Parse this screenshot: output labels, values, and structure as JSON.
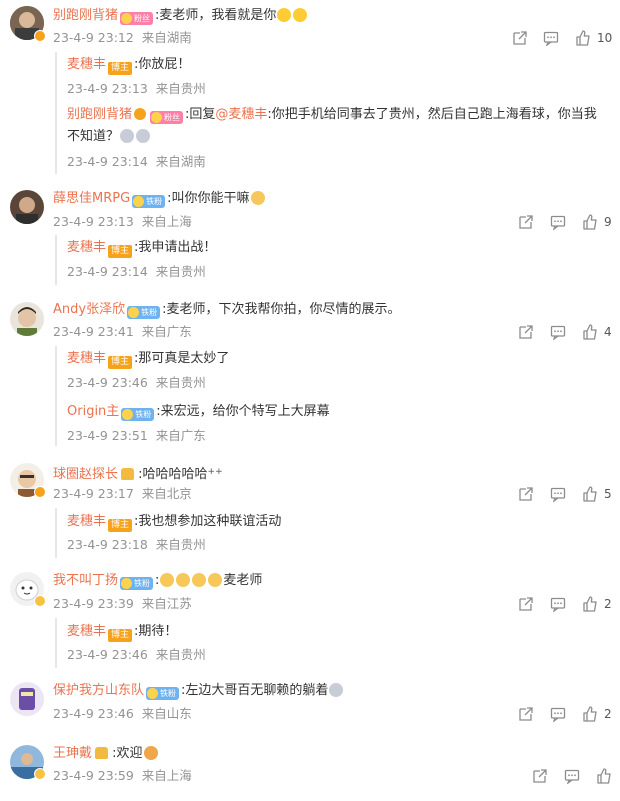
{
  "comments": [
    {
      "user": "别跑刚背猪",
      "badge": "粉丝",
      "text": ":麦老师，我看就是你",
      "time": "23-4-9 23:12",
      "location": "来自湖南",
      "likes": "10",
      "replies": [
        {
          "user": "麦穗丰",
          "badge": "博主",
          "text": ":你放屁！",
          "time": "23-4-9 23:13",
          "location": "来自贵州"
        },
        {
          "user": "别跑刚背猪",
          "badge": "粉丝",
          "text_prefix": ":回复",
          "mention": "@麦穗丰",
          "text": ":你把手机给同事去了贵州，然后自己跑上海看球，你当我",
          "text2": "不知道？",
          "time": "23-4-9 23:14",
          "location": "来自湖南"
        }
      ]
    },
    {
      "user": "薛思佳MRPG",
      "badge": "铁粉",
      "text": ":叫你你能干嘛",
      "time": "23-4-9 23:13",
      "location": "来自上海",
      "likes": "9",
      "replies": [
        {
          "user": "麦穗丰",
          "badge": "博主",
          "text": ":我申请出战！",
          "time": "23-4-9 23:14",
          "location": "来自贵州"
        }
      ]
    },
    {
      "user": "Andy张泽欣",
      "badge": "铁粉",
      "text": ":麦老师，下次我帮你拍，你尽情的展示。",
      "time": "23-4-9 23:41",
      "location": "来自广东",
      "likes": "4",
      "replies": [
        {
          "user": "麦穗丰",
          "badge": "博主",
          "text": ":那可真是太妙了",
          "time": "23-4-9 23:46",
          "location": "来自贵州"
        },
        {
          "user": "Origin主",
          "badge": "铁粉",
          "text": ":来宏远，给你个特写上大屏幕",
          "time": "23-4-9 23:51",
          "location": "来自广东"
        }
      ]
    },
    {
      "user": "球圈赵探长",
      "text": ":哈哈哈哈哈",
      "time": "23-4-9 23:17",
      "location": "来自北京",
      "likes": "5",
      "replies": [
        {
          "user": "麦穗丰",
          "badge": "博主",
          "text": ":我也想参加这种联谊活动",
          "time": "23-4-9 23:18",
          "location": "来自贵州"
        }
      ]
    },
    {
      "user": "我不叫丁扬",
      "badge": "铁粉",
      "text": ":",
      "text_suffix": "麦老师",
      "time": "23-4-9 23:39",
      "location": "来自江苏",
      "likes": "2",
      "replies": [
        {
          "user": "麦穗丰",
          "badge": "博主",
          "text": ":期待！",
          "time": "23-4-9 23:46",
          "location": "来自贵州"
        }
      ]
    },
    {
      "user": "保护我方山东队",
      "badge": "铁粉",
      "text": ":左边大哥百无聊赖的躺着",
      "time": "23-4-9 23:46",
      "location": "来自山东",
      "likes": "2",
      "replies": []
    },
    {
      "user": "王珅戴",
      "text": ":欢迎",
      "time": "23-4-9 23:59",
      "location": "来自上海",
      "likes": "",
      "replies": []
    }
  ],
  "colors": {
    "username": "#eb7350",
    "meta": "#939393",
    "icon": "#8c8c8c"
  },
  "icons": [
    "share-icon",
    "comment-icon",
    "like-icon"
  ]
}
